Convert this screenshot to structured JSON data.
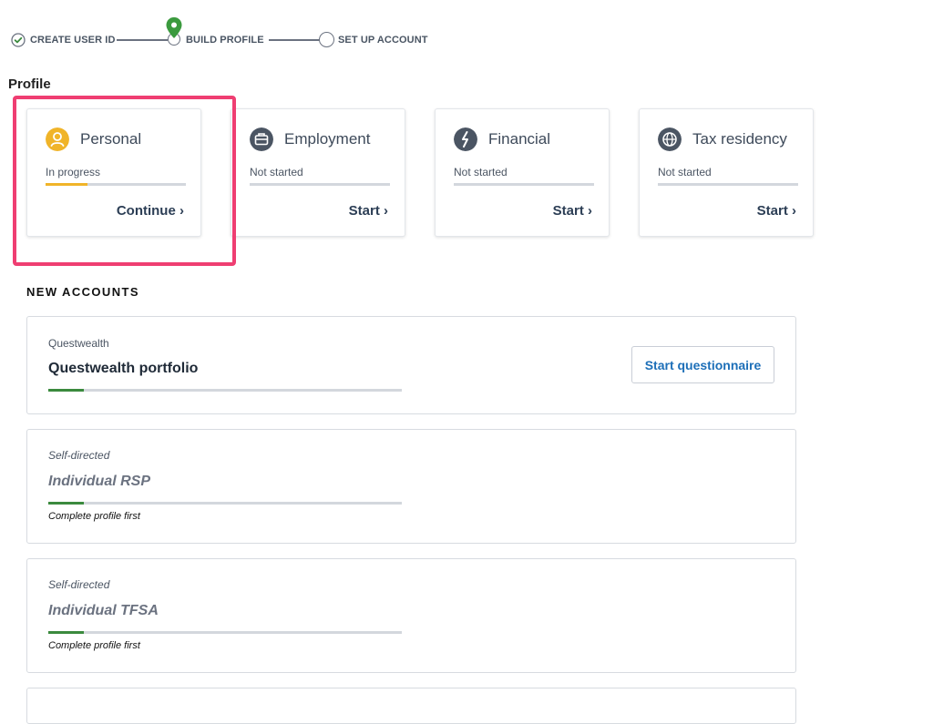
{
  "stepper": {
    "steps": [
      {
        "label": "CREATE USER ID",
        "state": "complete"
      },
      {
        "label": "BUILD PROFILE",
        "state": "current"
      },
      {
        "label": "SET UP ACCOUNT",
        "state": "upcoming"
      }
    ]
  },
  "profile": {
    "title": "Profile",
    "cards": [
      {
        "title": "Personal",
        "status": "In progress",
        "action": "Continue",
        "icon": "person-icon",
        "progress": 0.3
      },
      {
        "title": "Employment",
        "status": "Not started",
        "action": "Start",
        "icon": "briefcase-icon",
        "progress": 0
      },
      {
        "title": "Financial",
        "status": "Not started",
        "action": "Start",
        "icon": "money-icon",
        "progress": 0
      },
      {
        "title": "Tax residency",
        "status": "Not started",
        "action": "Start",
        "icon": "globe-icon",
        "progress": 0
      }
    ]
  },
  "new_accounts": {
    "title": "NEW ACCOUNTS",
    "items": [
      {
        "category": "Questwealth",
        "name": "Questwealth portfolio",
        "button": "Start questionnaire",
        "progress": 0.1
      },
      {
        "category": "Self-directed",
        "name": "Individual RSP",
        "note": "Complete profile first",
        "progress": 0.1
      },
      {
        "category": "Self-directed",
        "name": "Individual TFSA",
        "note": "Complete profile first",
        "progress": 0.1
      }
    ]
  },
  "colors": {
    "accent_green": "#3b8a3e",
    "in_progress_yellow": "#f0b429",
    "highlight_pink": "#ef3e72",
    "link_blue": "#1d6fb8",
    "icon_slate": "#4b5563"
  }
}
